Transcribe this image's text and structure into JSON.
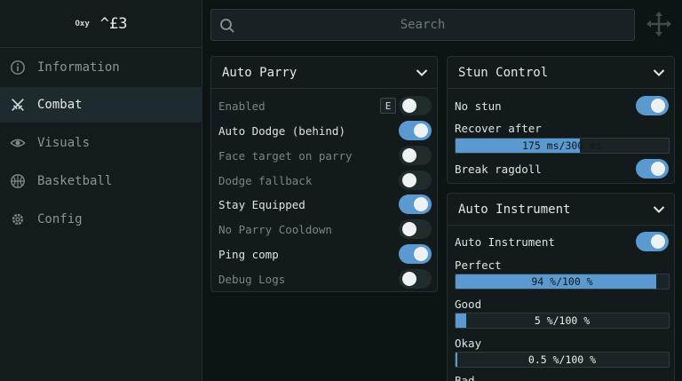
{
  "brand": {
    "small": "Oxy",
    "big": "^£3"
  },
  "nav": [
    {
      "label": "Information",
      "icon": "info-icon",
      "active": false
    },
    {
      "label": "Combat",
      "icon": "swords-icon",
      "active": true
    },
    {
      "label": "Visuals",
      "icon": "eye-icon",
      "active": false
    },
    {
      "label": "Basketball",
      "icon": "basketball-icon",
      "active": false
    },
    {
      "label": "Config",
      "icon": "gear-icon",
      "active": false
    }
  ],
  "search": {
    "placeholder": "Search"
  },
  "auto_parry": {
    "title": "Auto Parry",
    "keybind": "E",
    "rows": [
      {
        "label": "Enabled",
        "on": false
      },
      {
        "label": "Auto Dodge (behind)",
        "on": true
      },
      {
        "label": "Face target on parry",
        "on": false
      },
      {
        "label": "Dodge fallback",
        "on": false
      },
      {
        "label": "Stay Equipped",
        "on": true
      },
      {
        "label": "No Parry Cooldown",
        "on": false
      },
      {
        "label": "Ping comp",
        "on": true
      },
      {
        "label": "Debug Logs",
        "on": false
      }
    ]
  },
  "stun_control": {
    "title": "Stun Control",
    "no_stun": {
      "label": "No stun",
      "on": true
    },
    "recover": {
      "label": "Recover after",
      "value_text": "175 ms/300 ms",
      "fraction": 0.5833
    },
    "break_ragdoll": {
      "label": "Break ragdoll",
      "on": true
    }
  },
  "auto_instrument": {
    "title": "Auto Instrument",
    "toggle": {
      "label": "Auto Instrument",
      "on": true
    },
    "sliders": [
      {
        "label": "Perfect",
        "value_text": "94 %/100 %",
        "fraction": 0.94
      },
      {
        "label": "Good",
        "value_text": "5 %/100 %",
        "fraction": 0.05
      },
      {
        "label": "Okay",
        "value_text": "0.5 %/100 %",
        "fraction": 0.005
      }
    ],
    "next_label": "Bad"
  },
  "colors": {
    "accent": "#5b9ad1",
    "background": "#0d1414",
    "panel": "#121a1b"
  }
}
